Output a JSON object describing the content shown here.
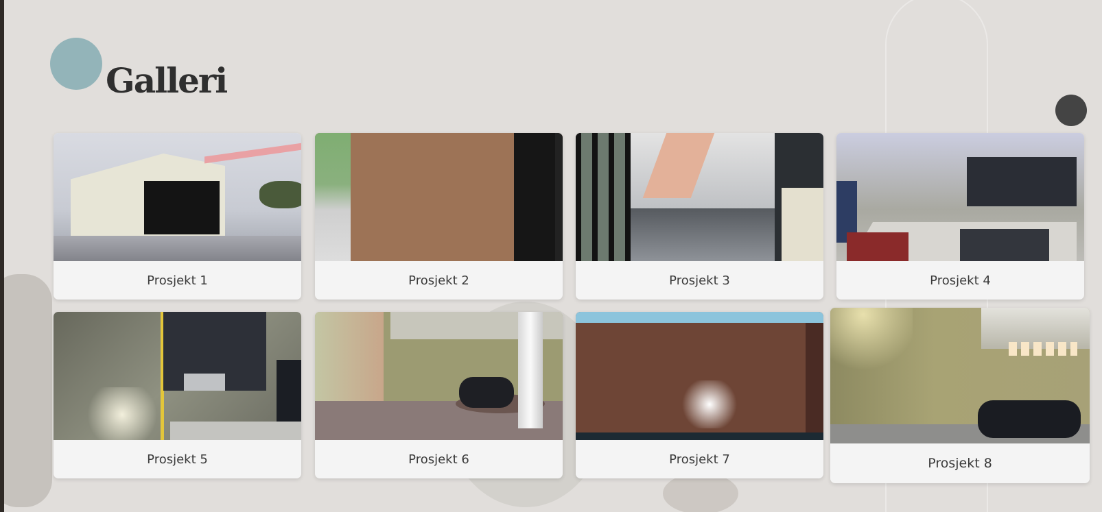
{
  "gallery": {
    "title": "Galleri",
    "cards": [
      {
        "label": "Prosjekt 1"
      },
      {
        "label": "Prosjekt 2"
      },
      {
        "label": "Prosjekt 3"
      },
      {
        "label": "Prosjekt 4"
      },
      {
        "label": "Prosjekt 5"
      },
      {
        "label": "Prosjekt 6"
      },
      {
        "label": "Prosjekt 7"
      },
      {
        "label": "Prosjekt 8"
      }
    ]
  },
  "theme": {
    "accent_circle": "#93b4b9",
    "background": "#e1dedb",
    "card": "#f4f4f4",
    "nav_dot": "#444444"
  }
}
